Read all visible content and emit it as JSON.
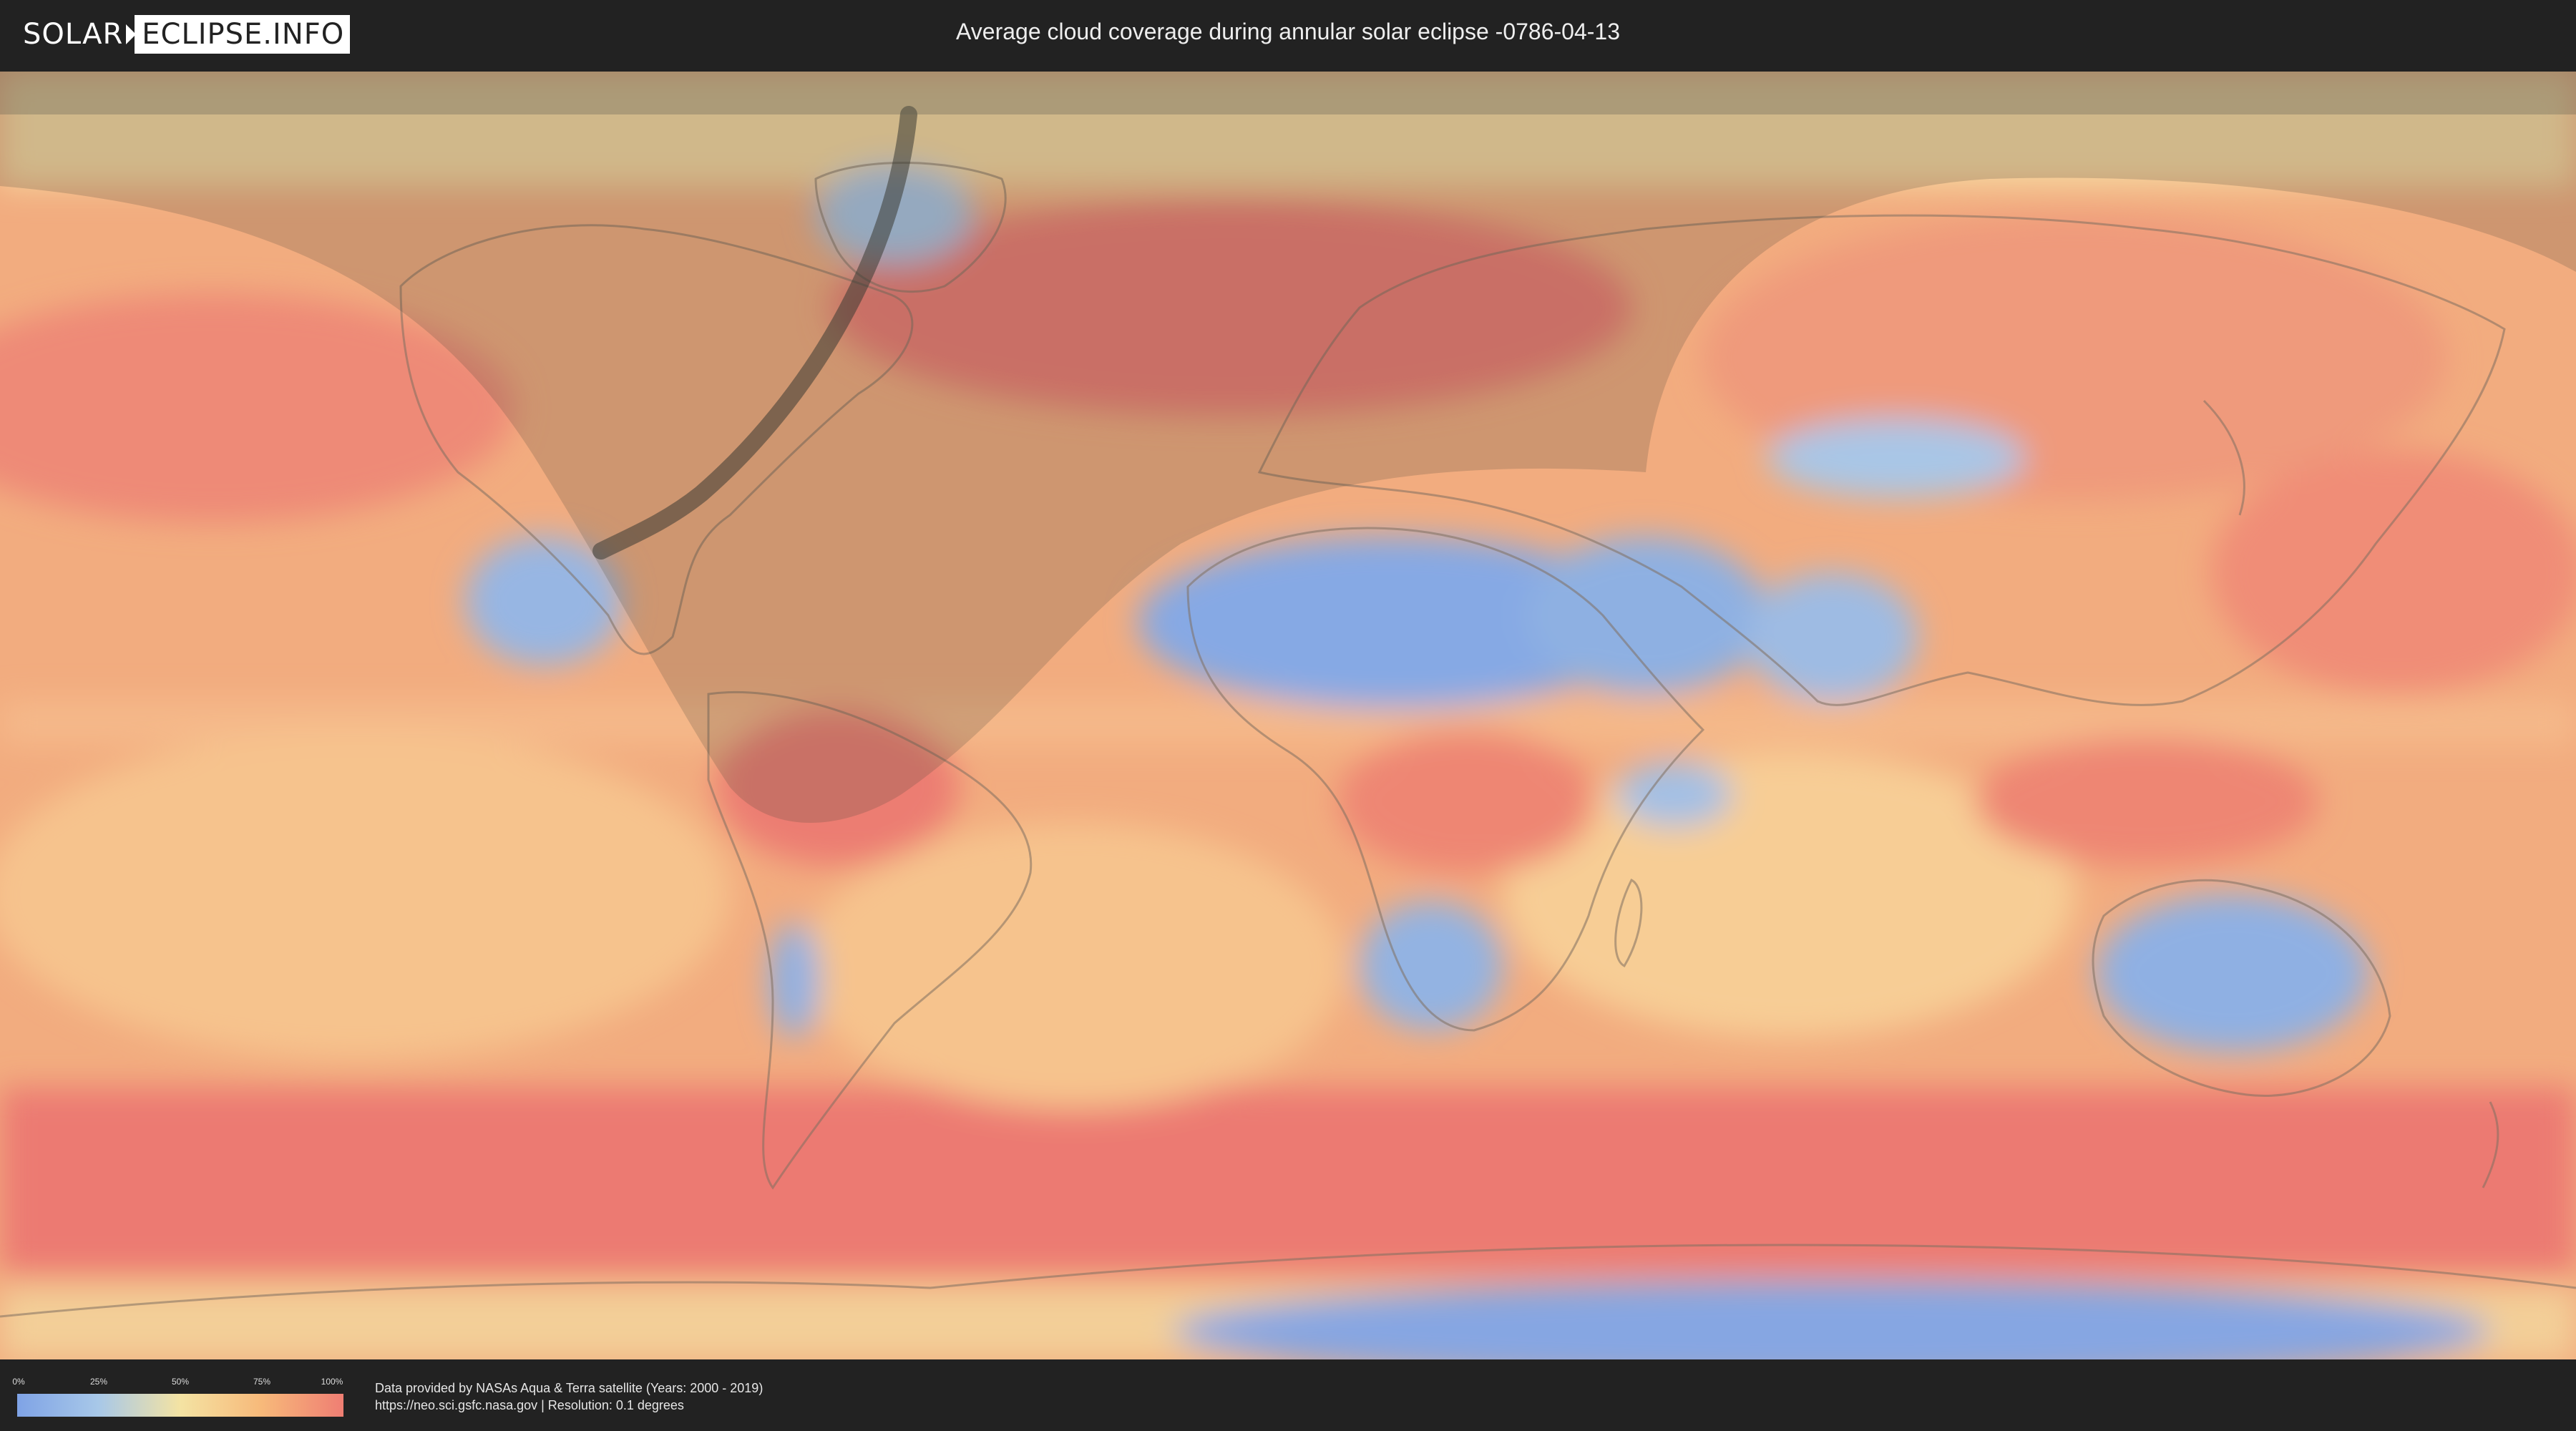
{
  "header": {
    "logo_left": "SOLAR",
    "logo_right": "ECLIPSE.INFO",
    "title": "Average cloud coverage during annular solar eclipse -0786-04-13"
  },
  "legend": {
    "ticks": [
      "0%",
      "25%",
      "50%",
      "75%",
      "100%"
    ],
    "colors": [
      "#7fa3e6",
      "#a8c8e8",
      "#f4e3a3",
      "#f7b97a",
      "#ef7e73"
    ]
  },
  "credits": {
    "line1": "Data provided by NASAs Aqua & Terra satellite (Years: 2000 - 2019)",
    "line2": "https://neo.sci.gsfc.nasa.gov | Resolution: 0.1 degrees"
  },
  "map": {
    "layer": "cloud coverage",
    "overlay": "eclipse visibility zone and annular path"
  }
}
